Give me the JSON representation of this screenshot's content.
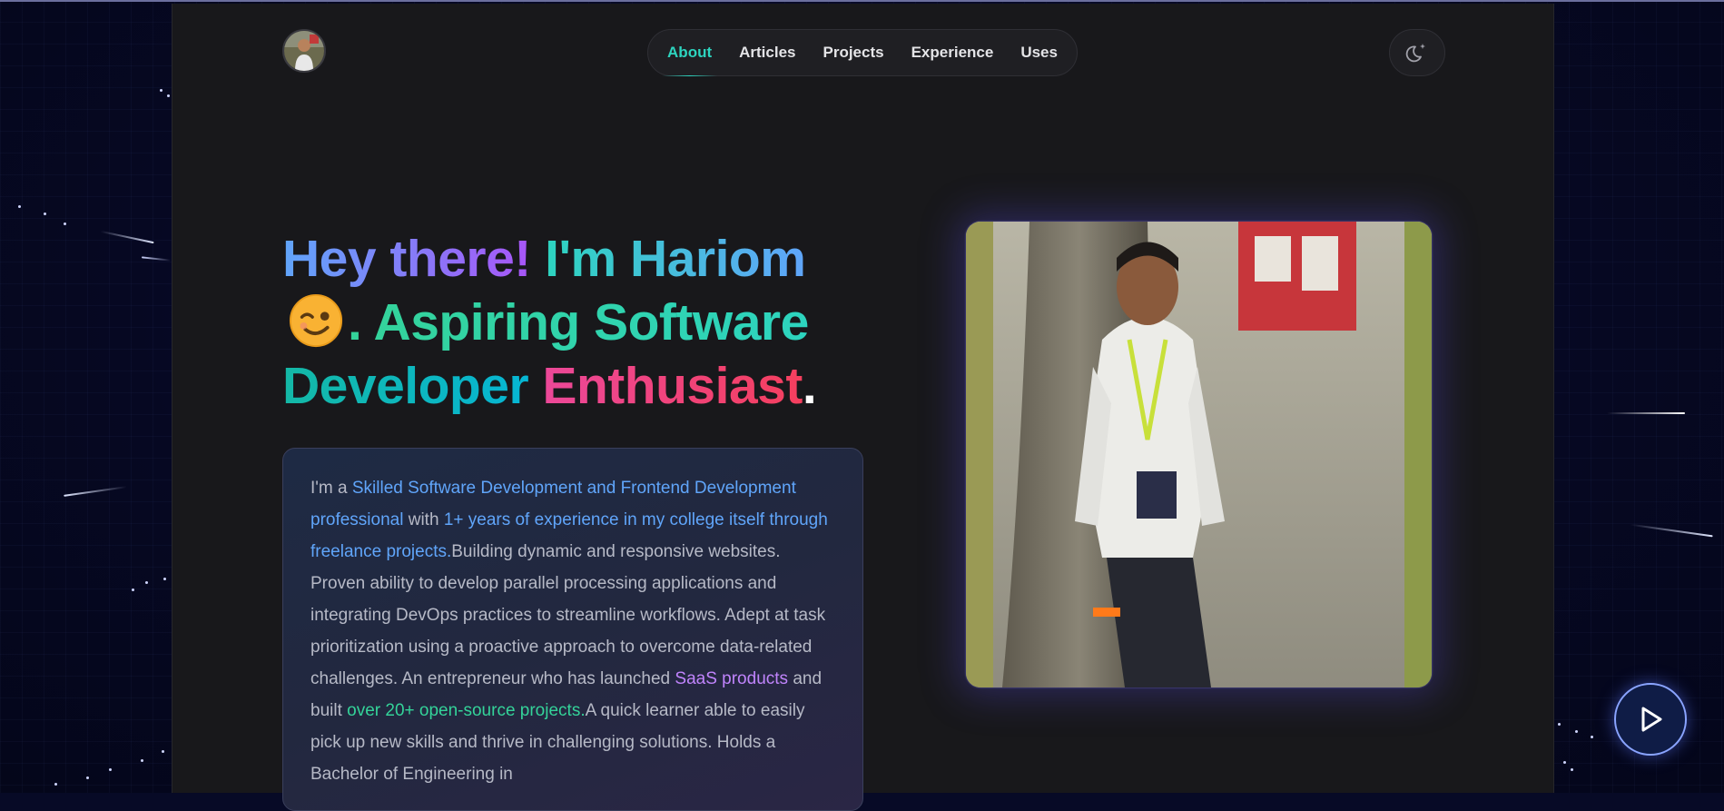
{
  "nav": {
    "items": [
      {
        "label": "About",
        "active": true
      },
      {
        "label": "Articles",
        "active": false
      },
      {
        "label": "Projects",
        "active": false
      },
      {
        "label": "Experience",
        "active": false
      },
      {
        "label": "Uses",
        "active": false
      }
    ]
  },
  "theme_toggle": {
    "icon": "moon-star-icon"
  },
  "hero": {
    "headline": {
      "part1": "Hey there!",
      "part2": "I'm Hariom",
      "emoji": "winking-face-emoji",
      "part3": ". Aspiring Software",
      "part4": "Developer",
      "part5": "Enthusiast",
      "part6": "."
    },
    "bio": {
      "t1": "I'm a ",
      "h1": "Skilled Software Development and Frontend Development professional",
      "t2": " with ",
      "h2": "1+ years of experience in my college itself through freelance projects.",
      "t3": "Building dynamic and responsive websites. Proven ability to develop parallel processing applications and integrating DevOps practices to streamline workflows. Adept at task prioritization using a proactive approach to overcome data-related challenges. An entrepreneur who has launched ",
      "h3": "SaaS products",
      "t4": " and built ",
      "h4": "over 20+ open-source projects.",
      "t5": "A quick learner able to easily pick up new skills and thrive in challenging solutions. Holds a Bachelor of Engineering in"
    }
  },
  "colors": {
    "accent": "#2dd4bf",
    "link_blue": "#60a5fa",
    "highlight_purple": "#c084fc",
    "highlight_green": "#34d399",
    "pink": "#ec4899"
  },
  "play_button": {
    "icon": "play-icon"
  }
}
